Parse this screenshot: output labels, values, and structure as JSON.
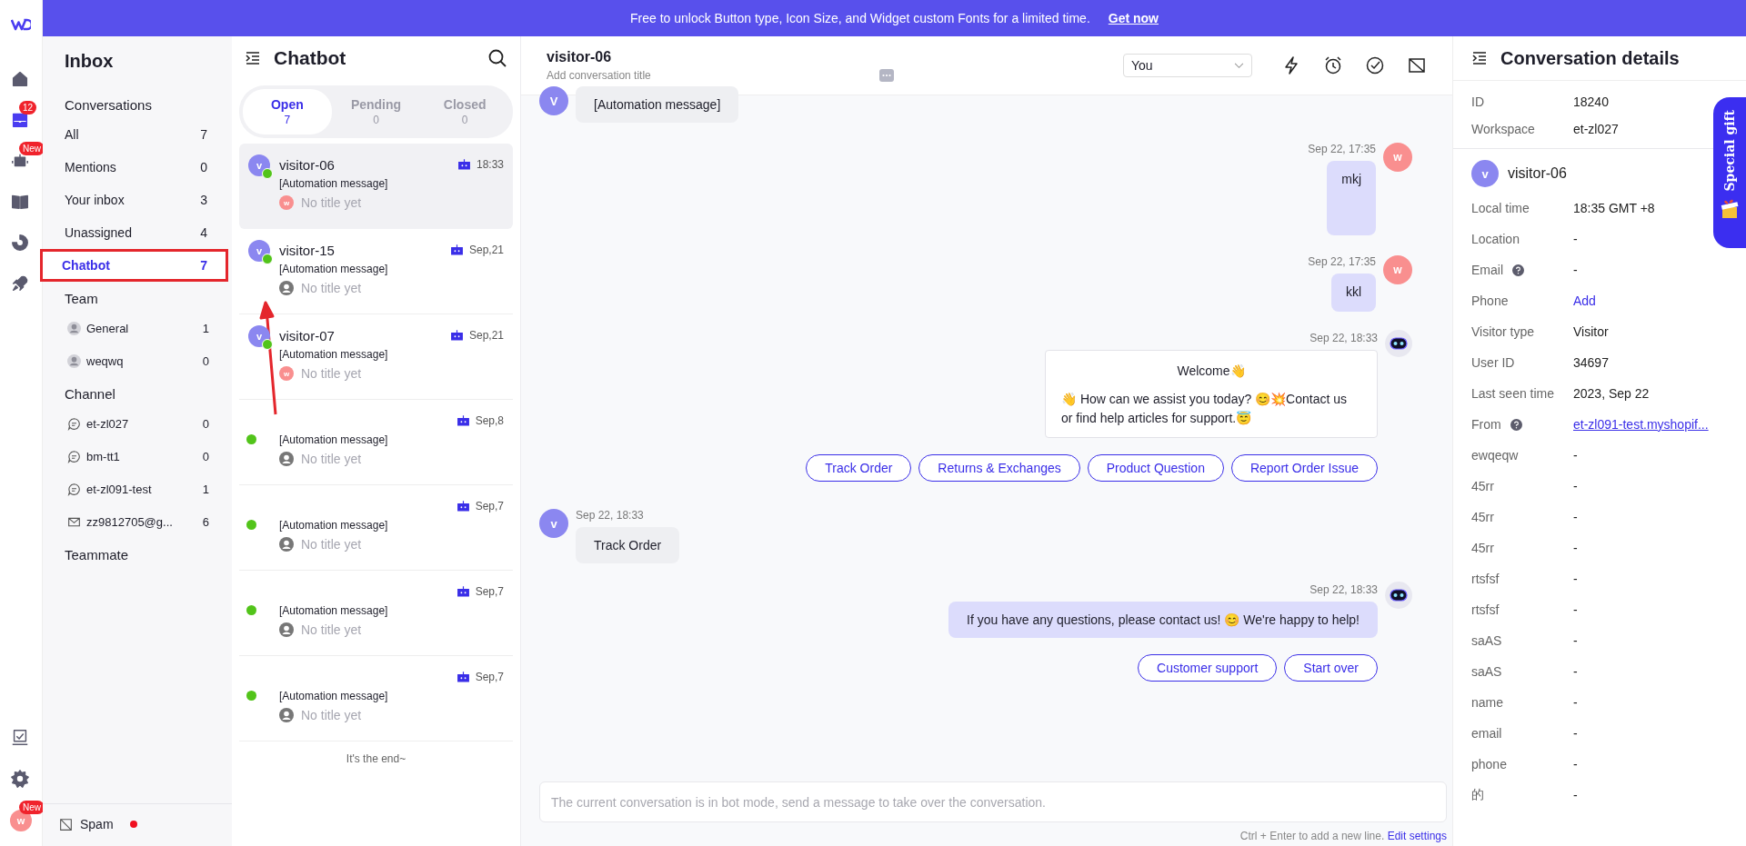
{
  "banner": {
    "text": "Free to unlock Button type, Icon Size, and Widget custom Fonts for a limited time.",
    "link": "Get now"
  },
  "rail": {
    "items": [
      {
        "kind": "home",
        "selected": false
      },
      {
        "kind": "inbox",
        "selected": true,
        "badge": "12"
      },
      {
        "kind": "bot",
        "selected": false,
        "badge": "New"
      },
      {
        "kind": "book",
        "selected": false
      },
      {
        "kind": "chart",
        "selected": false
      },
      {
        "kind": "rocket",
        "selected": false
      }
    ],
    "bottom": [
      {
        "kind": "tasks",
        "selected": false
      },
      {
        "kind": "settings",
        "selected": false
      }
    ],
    "user": {
      "initial": "w",
      "badge": "New"
    }
  },
  "inbox": {
    "title": "Inbox",
    "conversations": {
      "heading": "Conversations",
      "items": [
        {
          "label": "All",
          "count": "7",
          "selected": false,
          "highlighted": false
        },
        {
          "label": "Mentions",
          "count": "0",
          "selected": false,
          "highlighted": false
        },
        {
          "label": "Your inbox",
          "count": "3",
          "selected": false,
          "highlighted": false
        },
        {
          "label": "Unassigned",
          "count": "4",
          "selected": false,
          "highlighted": false
        },
        {
          "label": "Chatbot",
          "count": "7",
          "selected": true,
          "highlighted": true
        }
      ]
    },
    "team": {
      "heading": "Team",
      "items": [
        {
          "label": "General",
          "count": "1"
        },
        {
          "label": "weqwq",
          "count": "0"
        }
      ]
    },
    "channel": {
      "heading": "Channel",
      "items": [
        {
          "kind": "chat",
          "label": "et-zl027",
          "count": "0"
        },
        {
          "kind": "chat",
          "label": "bm-tt1",
          "count": "0"
        },
        {
          "kind": "chat",
          "label": "et-zl091-test",
          "count": "1"
        },
        {
          "kind": "mail",
          "label": "zz9812705@g...",
          "count": "6"
        }
      ]
    },
    "teammate": {
      "heading": "Teammate"
    },
    "spam": {
      "label": "Spam",
      "unread": true
    }
  },
  "list": {
    "title": "Chatbot",
    "tabs": [
      {
        "label": "Open",
        "count": "7",
        "selected": true
      },
      {
        "label": "Pending",
        "count": "0",
        "selected": false
      },
      {
        "label": "Closed",
        "count": "0",
        "selected": false
      }
    ],
    "conversations": [
      {
        "avatar": "v",
        "name": "visitor-06",
        "time": "18:33",
        "message": "[Automation message]",
        "subtitle": "No title yet",
        "assignee": "w",
        "online": true,
        "selected": true
      },
      {
        "avatar": "v",
        "name": "visitor-15",
        "time": "Sep,21",
        "message": "[Automation message]",
        "subtitle": "No title yet",
        "online": true,
        "selected": false
      },
      {
        "avatar": "v",
        "name": "visitor-07",
        "time": "Sep,21",
        "message": "[Automation message]",
        "subtitle": "No title yet",
        "assignee": "w",
        "online": true,
        "selected": false
      },
      {
        "time": "Sep,8",
        "message": "[Automation message]",
        "subtitle": "No title yet",
        "online": true,
        "selected": false
      },
      {
        "time": "Sep,7",
        "message": "[Automation message]",
        "subtitle": "No title yet",
        "online": true,
        "selected": false
      },
      {
        "time": "Sep,7",
        "message": "[Automation message]",
        "subtitle": "No title yet",
        "online": true,
        "selected": false
      },
      {
        "time": "Sep,7",
        "message": "[Automation message]",
        "subtitle": "No title yet",
        "online": true,
        "selected": false
      }
    ],
    "end": "It's the end~"
  },
  "chat": {
    "name": "visitor-06",
    "title_placeholder": "Add conversation title",
    "assignee": "You",
    "messages": [
      {
        "kind": "visitor",
        "avatar": "V",
        "text": "[Automation message]"
      },
      {
        "kind": "agent",
        "avatar": "w",
        "time": "Sep 22, 17:35",
        "text": "mkj",
        "tall": true
      },
      {
        "kind": "agent",
        "avatar": "w",
        "time": "Sep 22, 17:35",
        "text": "kkl",
        "tall": false
      },
      {
        "kind": "bot_card",
        "time": "Sep 22, 18:33",
        "title": "Welcome👋",
        "text": "👋 How can we assist you today? 😊💥Contact us or find help articles for support.😇",
        "buttons": [
          "Track Order",
          "Returns & Exchanges",
          "Product Question",
          "Report Order Issue"
        ]
      },
      {
        "kind": "visitor",
        "avatar": "v",
        "time": "Sep 22, 18:33",
        "text": "Track Order"
      },
      {
        "kind": "bot",
        "time": "Sep 22, 18:33",
        "text": "If you have any questions, please contact us! 😊 We're happy to help!",
        "buttons": [
          "Customer support",
          "Start over"
        ]
      }
    ],
    "composer": {
      "placeholder": "The current conversation is in bot mode, send a message to take over the conversation."
    },
    "hint": "Ctrl + Enter to add a new line.",
    "hint_link": "Edit settings"
  },
  "details": {
    "title": "Conversation details",
    "meta": [
      {
        "label": "ID",
        "value": "18240"
      },
      {
        "label": "Workspace",
        "value": "et-zl027"
      }
    ],
    "visitor": {
      "avatar": "v",
      "name": "visitor-06"
    },
    "fields": [
      {
        "label": "Local time",
        "value": "18:35 GMT +8",
        "kind": "text"
      },
      {
        "label": "Location",
        "value": "-",
        "kind": "text"
      },
      {
        "label": "Email",
        "value": "-",
        "kind": "text",
        "help": true
      },
      {
        "label": "Phone",
        "value": "Add",
        "kind": "action"
      },
      {
        "label": "Visitor type",
        "value": "Visitor",
        "kind": "text"
      },
      {
        "label": "User ID",
        "value": "34697",
        "kind": "text"
      },
      {
        "label": "Last seen time",
        "value": "2023, Sep 22",
        "kind": "text"
      },
      {
        "label": "From",
        "value": "et-zl091-test.myshopif...",
        "kind": "link",
        "help": true
      },
      {
        "label": "ewqeqw",
        "value": "-",
        "kind": "text"
      },
      {
        "label": "45rr",
        "value": "-",
        "kind": "text"
      },
      {
        "label": "45rr",
        "value": "-",
        "kind": "text"
      },
      {
        "label": "45rr",
        "value": "-",
        "kind": "text"
      },
      {
        "label": "rtsfsf",
        "value": "-",
        "kind": "text"
      },
      {
        "label": "rtsfsf",
        "value": "-",
        "kind": "text"
      },
      {
        "label": "saAS",
        "value": "-",
        "kind": "text"
      },
      {
        "label": "saAS",
        "value": "-",
        "kind": "text"
      },
      {
        "label": "name",
        "value": "-",
        "kind": "text"
      },
      {
        "label": "email",
        "value": "-",
        "kind": "text"
      },
      {
        "label": "phone",
        "value": "-",
        "kind": "text"
      },
      {
        "label": "的",
        "value": "-",
        "kind": "text"
      }
    ],
    "promo": "Special gift"
  }
}
